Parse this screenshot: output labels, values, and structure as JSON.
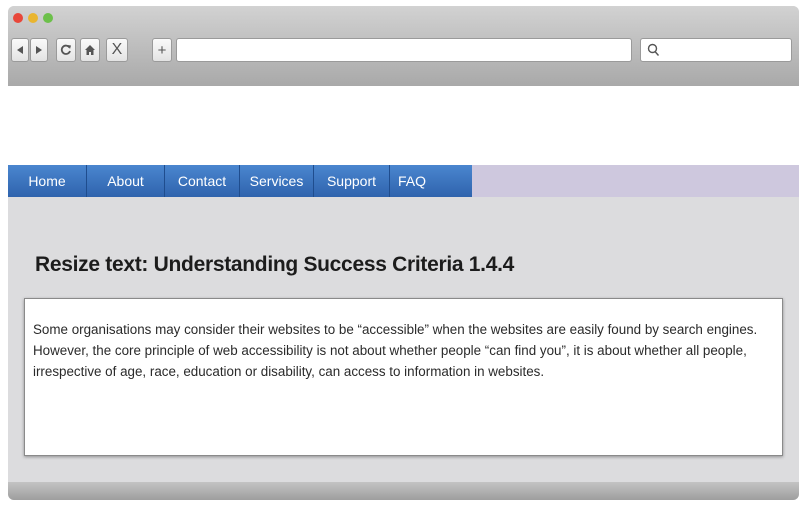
{
  "browser": {
    "toolbar": {
      "back_icon": "back-arrow-icon",
      "forward_icon": "forward-arrow-icon",
      "reload_icon": "reload-icon",
      "home_icon": "home-icon",
      "stop_label": "X",
      "new_tab_label": "+",
      "search_icon": "search-icon"
    },
    "address_bar": {
      "value": ""
    },
    "search_field": {
      "value": ""
    }
  },
  "nav": {
    "items": [
      "Home",
      "About",
      "Contact",
      "Services",
      "Support",
      "FAQ"
    ],
    "bar_color": "#3b73bf",
    "bg_color": "#cec8de"
  },
  "main": {
    "heading": "Resize text: Understanding Success Criteria 1.4.4",
    "paragraph": "Some organisations may consider their websites to be “accessible” when the websites are easily found by search engines. However, the core principle of web accessibility is not about whether people “can find you”, it is about whether all people, irrespective of age, race, education or disability, can access to information in websites."
  }
}
